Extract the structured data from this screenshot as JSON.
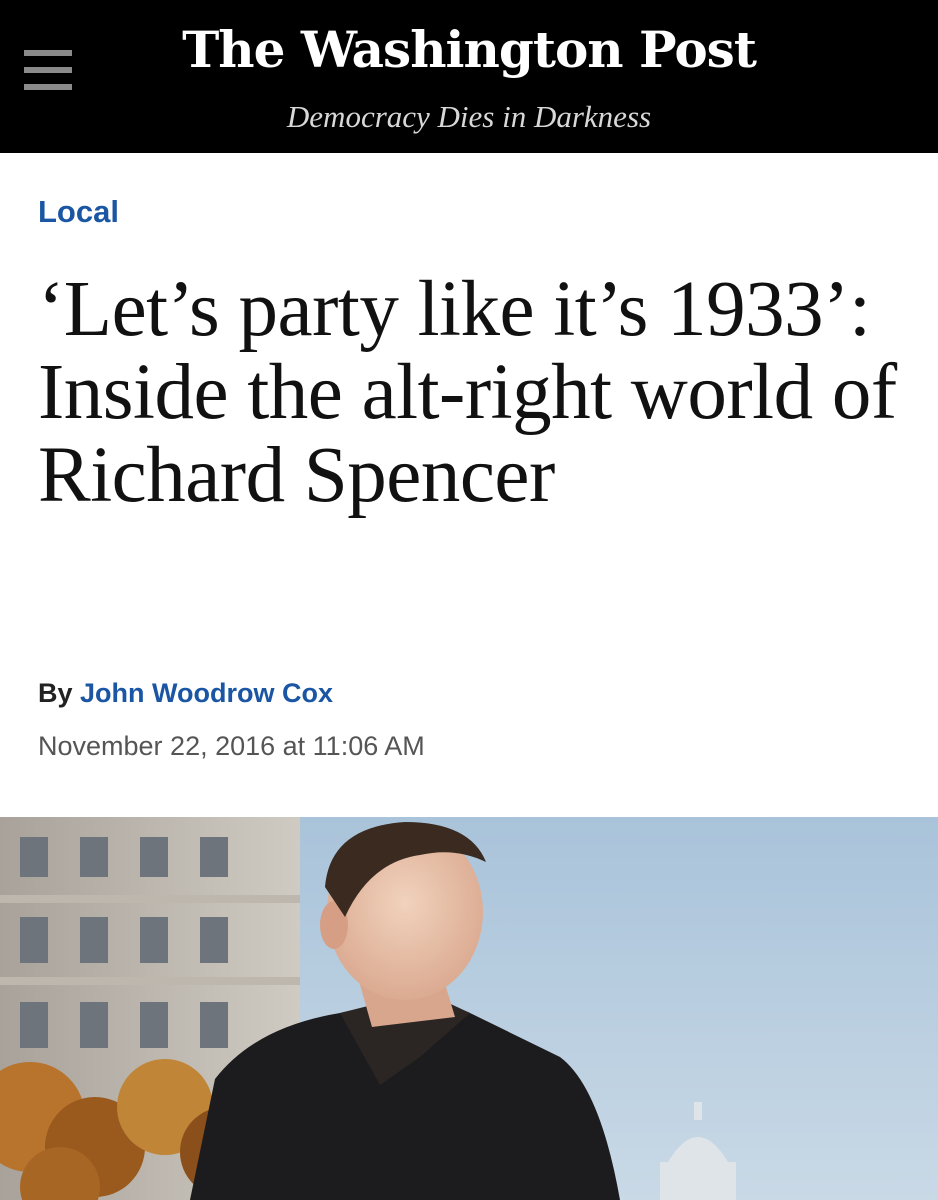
{
  "header": {
    "masthead": "The Washington Post",
    "tagline": "Democracy Dies in Darkness",
    "menu_icon": "hamburger-menu-icon",
    "background_color": "#000000"
  },
  "article": {
    "section": "Local",
    "headline": "‘Let’s party like it’s 1933’: Inside the alt-right world of Richard Spencer",
    "byline_prefix": "By",
    "author": "John Woodrow Cox",
    "timestamp": "November 22, 2016 at 11:06 AM",
    "link_color": "#1a56a3"
  }
}
